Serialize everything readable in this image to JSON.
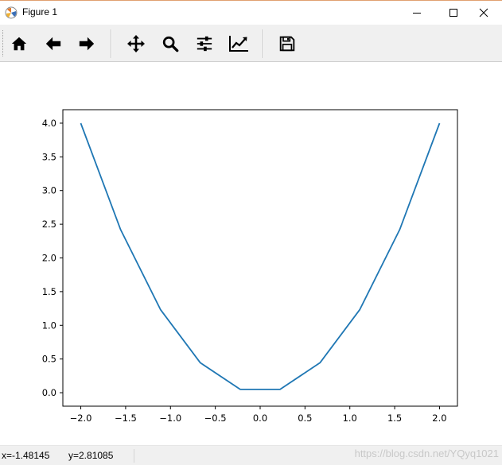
{
  "window": {
    "title": "Figure 1",
    "minimize_icon": "minimize-icon",
    "maximize_icon": "maximize-icon",
    "close_icon": "close-icon"
  },
  "toolbar": {
    "buttons": [
      {
        "id": "home",
        "icon": "home-icon"
      },
      {
        "id": "back",
        "icon": "arrow-left-icon"
      },
      {
        "id": "forward",
        "icon": "arrow-right-icon"
      },
      {
        "id": "pan",
        "icon": "move-icon"
      },
      {
        "id": "zoom",
        "icon": "magnifier-icon"
      },
      {
        "id": "subplots",
        "icon": "sliders-icon"
      },
      {
        "id": "edit",
        "icon": "line-chart-icon"
      },
      {
        "id": "save",
        "icon": "floppy-disk-icon"
      }
    ]
  },
  "chart_data": {
    "type": "line",
    "x": [
      -2.0,
      -1.5556,
      -1.1111,
      -0.6667,
      -0.2222,
      0.2222,
      0.6667,
      1.1111,
      1.5556,
      2.0
    ],
    "series": [
      {
        "values": [
          4.0,
          2.42,
          1.235,
          0.444,
          0.049,
          0.049,
          0.444,
          1.235,
          2.42,
          4.0
        ],
        "color": "#1f77b4"
      }
    ],
    "xlim": [
      -2.2,
      2.2
    ],
    "ylim": [
      -0.2,
      4.2
    ],
    "xticks": [
      -2.0,
      -1.5,
      -1.0,
      -0.5,
      0.0,
      0.5,
      1.0,
      1.5,
      2.0
    ],
    "xtick_labels": [
      "−2.0",
      "−1.5",
      "−1.0",
      "−0.5",
      "0.0",
      "0.5",
      "1.0",
      "1.5",
      "2.0"
    ],
    "yticks": [
      0.0,
      0.5,
      1.0,
      1.5,
      2.0,
      2.5,
      3.0,
      3.5,
      4.0
    ],
    "ytick_labels": [
      "0.0",
      "0.5",
      "1.0",
      "1.5",
      "2.0",
      "2.5",
      "3.0",
      "3.5",
      "4.0"
    ],
    "grid": false,
    "title": "",
    "xlabel": "",
    "ylabel": ""
  },
  "status": {
    "x_readout": "x=-1.48145",
    "y_readout": "y=2.81085"
  },
  "watermark": "https://blog.csdn.net/YQyq1021"
}
